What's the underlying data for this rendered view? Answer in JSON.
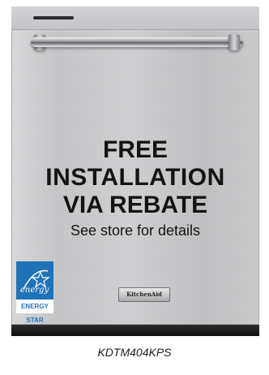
{
  "product": {
    "brand_badge": "KitchenAid",
    "model_number": "KDTM404KPS"
  },
  "promo": {
    "line1": "FREE",
    "line2": "INSTALLATION",
    "line3": "VIA REBATE",
    "details": "See store for details"
  },
  "energy_star": {
    "logo_text": "energy",
    "label": "ENERGY STAR",
    "color": "#1e73b8"
  },
  "colors": {
    "stainless": "#c9cacc",
    "promo_text": "#141414",
    "toe_kick": "#1a1a1a"
  }
}
